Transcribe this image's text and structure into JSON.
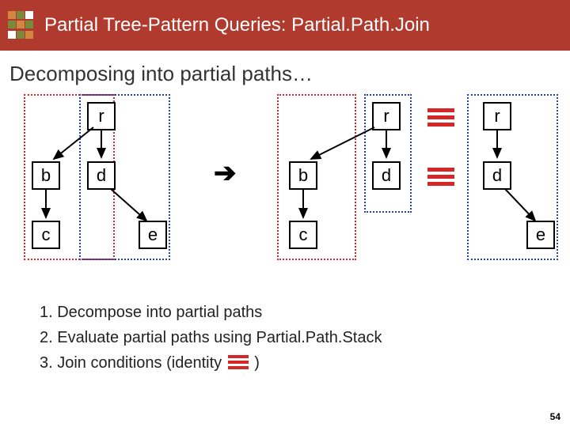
{
  "header": {
    "title": "Partial Tree-Pattern Queries: Partial.Path.Join"
  },
  "subtitle": "Decomposing into partial paths…",
  "nodes": {
    "r": "r",
    "b": "b",
    "d": "d",
    "c": "c",
    "e": "e"
  },
  "symbols": {
    "implies": "➔"
  },
  "steps": {
    "s1": "1. Decompose into partial paths",
    "s2": "2. Evaluate partial paths using Partial.Path.Stack",
    "s3": "3. Join conditions (identity ",
    "s3b": ")"
  },
  "pagenum": "54"
}
